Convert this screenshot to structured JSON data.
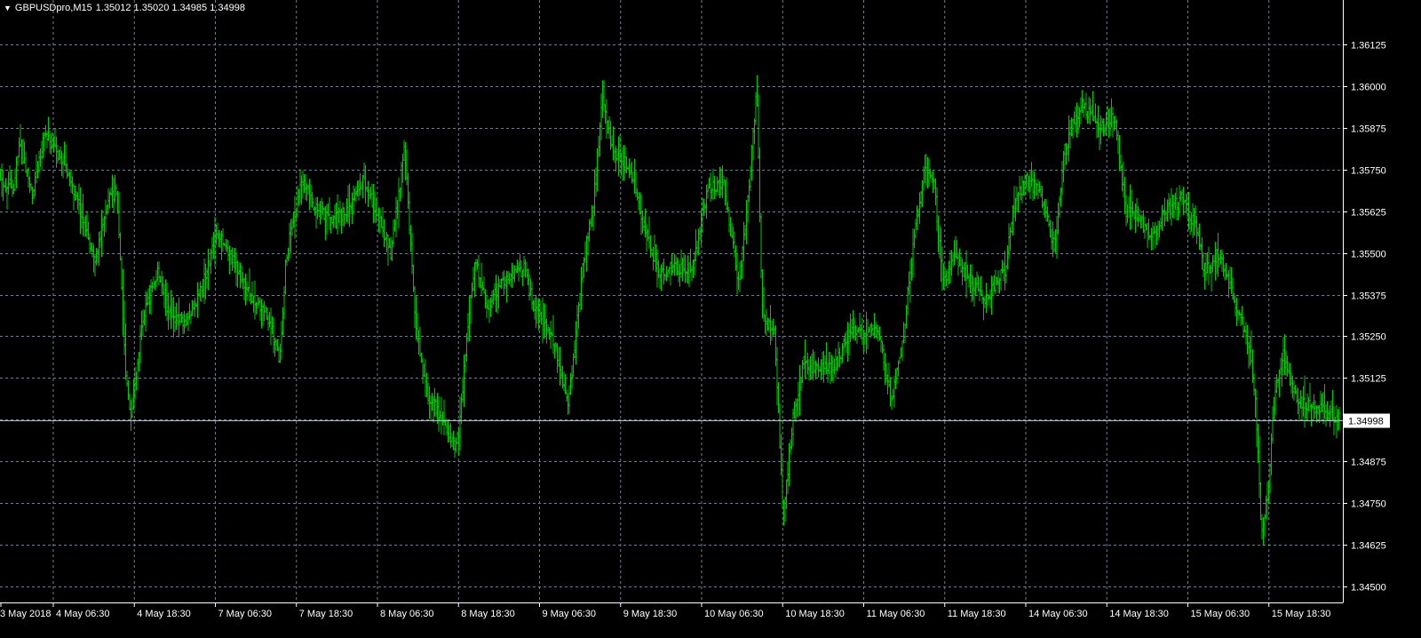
{
  "header": {
    "menu_icon": "triangle-down-icon",
    "symbol": "GBPUSDpro,M15",
    "quote": "1.35012 1.35020 1.34985 1.34998"
  },
  "colors": {
    "background": "#000000",
    "bars": "#00c800",
    "grid": "#6b7f8f",
    "axis_text": "#ffffff",
    "price_line": "#b0bcc6"
  },
  "chart_data": {
    "type": "bar",
    "style": "ohlc-bars",
    "timeframe": "M15",
    "grid": true,
    "current_price": 1.34998,
    "current_price_label": "1.34998",
    "y_axis": {
      "position": "right",
      "min": 1.3445,
      "max": 1.3623,
      "ticks": [
        1.36125,
        1.36,
        1.35875,
        1.3575,
        1.35625,
        1.355,
        1.35375,
        1.3525,
        1.35125,
        1.35,
        1.34875,
        1.3475,
        1.34625,
        1.345
      ],
      "tick_labels": [
        "1.36125",
        "1.36000",
        "1.35875",
        "1.35750",
        "1.35625",
        "1.35500",
        "1.35375",
        "1.35250",
        "1.35125",
        "",
        "1.34875",
        "1.34750",
        "1.34625",
        "1.34500"
      ]
    },
    "x_axis": {
      "position": "bottom",
      "tick_labels": [
        "3 May 2018",
        "4 May 06:30",
        "4 May 18:30",
        "7 May 06:30",
        "7 May 18:30",
        "8 May 06:30",
        "8 May 18:30",
        "9 May 06:30",
        "9 May 18:30",
        "10 May 06:30",
        "10 May 18:30",
        "11 May 06:30",
        "11 May 18:30",
        "14 May 06:30",
        "14 May 18:30",
        "15 May 06:30",
        "15 May 18:30"
      ]
    },
    "series": [
      {
        "path": [
          [
            0,
            1.3572
          ],
          [
            15,
            1.357
          ],
          [
            22,
            1.3582
          ],
          [
            36,
            1.3568
          ],
          [
            50,
            1.3586
          ],
          [
            74,
            1.3576
          ],
          [
            93,
            1.356
          ],
          [
            107,
            1.3546
          ],
          [
            121,
            1.3566
          ],
          [
            132,
            1.3568
          ],
          [
            142,
            1.3512
          ],
          [
            148,
            1.35
          ],
          [
            160,
            1.353
          ],
          [
            177,
            1.3544
          ],
          [
            193,
            1.353
          ],
          [
            210,
            1.3529
          ],
          [
            230,
            1.3542
          ],
          [
            245,
            1.3556
          ],
          [
            262,
            1.3548
          ],
          [
            280,
            1.3538
          ],
          [
            300,
            1.3532
          ],
          [
            315,
            1.3518
          ],
          [
            322,
            1.3549
          ],
          [
            340,
            1.3572
          ],
          [
            352,
            1.3564
          ],
          [
            375,
            1.356
          ],
          [
            390,
            1.3562
          ],
          [
            410,
            1.3572
          ],
          [
            425,
            1.3561
          ],
          [
            440,
            1.355
          ],
          [
            450,
            1.3569
          ],
          [
            455,
            1.3583
          ],
          [
            460,
            1.3562
          ],
          [
            467,
            1.3531
          ],
          [
            480,
            1.3508
          ],
          [
            500,
            1.3499
          ],
          [
            515,
            1.3491
          ],
          [
            525,
            1.3522
          ],
          [
            535,
            1.3549
          ],
          [
            548,
            1.3534
          ],
          [
            565,
            1.3541
          ],
          [
            590,
            1.3545
          ],
          [
            602,
            1.3533
          ],
          [
            622,
            1.3525
          ],
          [
            640,
            1.3504
          ],
          [
            655,
            1.3544
          ],
          [
            668,
            1.3565
          ],
          [
            678,
            1.3596
          ],
          [
            690,
            1.358
          ],
          [
            708,
            1.3576
          ],
          [
            722,
            1.356
          ],
          [
            742,
            1.3544
          ],
          [
            762,
            1.3546
          ],
          [
            780,
            1.3545
          ],
          [
            797,
            1.357
          ],
          [
            815,
            1.357
          ],
          [
            832,
            1.354
          ],
          [
            845,
            1.3575
          ],
          [
            852,
            1.36
          ],
          [
            858,
            1.3533
          ],
          [
            872,
            1.3525
          ],
          [
            882,
            1.3471
          ],
          [
            892,
            1.3499
          ],
          [
            905,
            1.3517
          ],
          [
            925,
            1.3515
          ],
          [
            940,
            1.3516
          ],
          [
            958,
            1.3527
          ],
          [
            975,
            1.3526
          ],
          [
            990,
            1.3527
          ],
          [
            1003,
            1.3506
          ],
          [
            1015,
            1.3521
          ],
          [
            1030,
            1.3556
          ],
          [
            1040,
            1.3575
          ],
          [
            1052,
            1.357
          ],
          [
            1062,
            1.3541
          ],
          [
            1075,
            1.3549
          ],
          [
            1095,
            1.3541
          ],
          [
            1110,
            1.3536
          ],
          [
            1132,
            1.3545
          ],
          [
            1142,
            1.3565
          ],
          [
            1155,
            1.3572
          ],
          [
            1170,
            1.3568
          ],
          [
            1188,
            1.3551
          ],
          [
            1198,
            1.3581
          ],
          [
            1218,
            1.3595
          ],
          [
            1238,
            1.3587
          ],
          [
            1255,
            1.3591
          ],
          [
            1268,
            1.3562
          ],
          [
            1282,
            1.3561
          ],
          [
            1298,
            1.3554
          ],
          [
            1312,
            1.3562
          ],
          [
            1330,
            1.3566
          ],
          [
            1348,
            1.3557
          ],
          [
            1357,
            1.3544
          ],
          [
            1372,
            1.355
          ],
          [
            1385,
            1.3539
          ],
          [
            1398,
            1.353
          ],
          [
            1408,
            1.3518
          ],
          [
            1414,
            1.3505
          ],
          [
            1420,
            1.3467
          ],
          [
            1428,
            1.3478
          ],
          [
            1435,
            1.3507
          ],
          [
            1445,
            1.3519
          ],
          [
            1460,
            1.3505
          ],
          [
            1475,
            1.3505
          ],
          [
            1492,
            1.3502
          ],
          [
            1505,
            1.35
          ],
          [
            1512,
            1.34998
          ]
        ]
      }
    ]
  }
}
